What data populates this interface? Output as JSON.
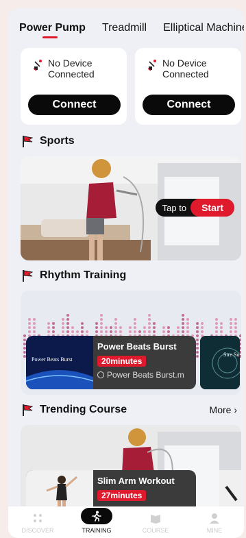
{
  "tabs": [
    {
      "label": "Power Pump"
    },
    {
      "label": "Treadmill"
    },
    {
      "label": "Elliptical Machine"
    }
  ],
  "devices": [
    {
      "status_line1": "No Device",
      "status_line2": "Connected",
      "button": "Connect"
    },
    {
      "status_line1": "No Device",
      "status_line2": "Connected",
      "button": "Connect"
    }
  ],
  "sports": {
    "title": "Sports",
    "tap_label": "Tap to",
    "start_label": "Start"
  },
  "rhythm": {
    "title": "Rhythm Training",
    "card": {
      "thumb_text": "Power Beats Burst",
      "title": "Power Beats Burst",
      "minutes": "20minutes",
      "file": "Power Beats Burst.m"
    },
    "side_card_text": "Stre Su"
  },
  "trending": {
    "title": "Trending Course",
    "more_label": "More",
    "card": {
      "title": "Slim Arm Workout",
      "minutes": "27minutes"
    }
  },
  "nav": [
    {
      "label": "DISCOVER",
      "icon": "discover-icon"
    },
    {
      "label": "TRAINING",
      "icon": "training-icon"
    },
    {
      "label": "COURSE",
      "icon": "course-icon"
    },
    {
      "label": "MINE",
      "icon": "mine-icon"
    }
  ],
  "colors": {
    "accent": "#e01a2d",
    "button_dark": "#0a0a0a",
    "page_bg": "#eef0f5"
  }
}
